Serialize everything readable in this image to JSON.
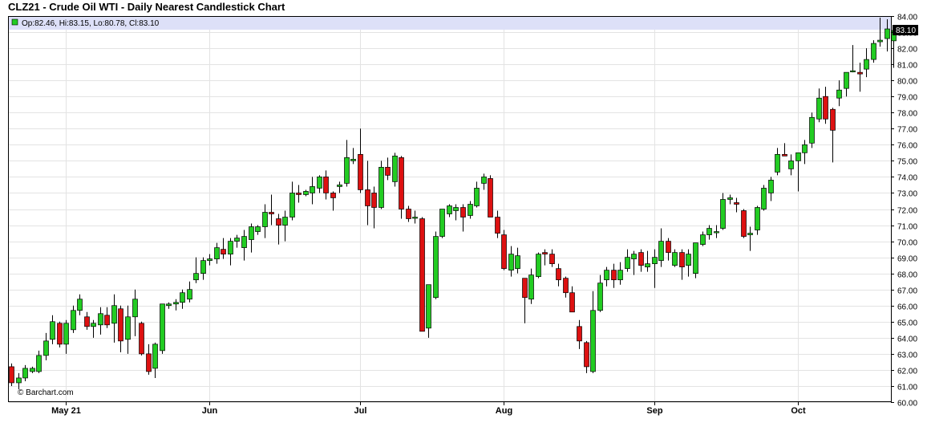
{
  "header": {
    "title": "CLZ21 - Crude Oil WTI - Daily Nearest Candlestick Chart"
  },
  "info_bar": {
    "ohlc_text": "Op:82.46, Hi:83.15, Lo:80.78, Cl:83.10",
    "last_price_label": "83.10"
  },
  "watermark": "© Barchart.com",
  "colors": {
    "up": "#22cc22",
    "down": "#dd1111",
    "grid": "#e3e3e3",
    "info_bar_bg": "#dde0f8",
    "info_swatch": "#22cc22"
  },
  "chart_data": {
    "type": "candlestick",
    "title": "CLZ21 - Crude Oil WTI - Daily Nearest Candlestick Chart",
    "ylim": [
      60,
      84
    ],
    "y_ticks": [
      "60.00",
      "61.00",
      "62.00",
      "63.00",
      "64.00",
      "65.00",
      "66.00",
      "67.00",
      "68.00",
      "69.00",
      "70.00",
      "71.00",
      "72.00",
      "73.00",
      "74.00",
      "75.00",
      "76.00",
      "77.00",
      "78.00",
      "79.00",
      "80.00",
      "81.00",
      "82.00",
      "83.00",
      "84.00"
    ],
    "x_month_labels": [
      {
        "label": "May 21",
        "index": 8
      },
      {
        "label": "Jun",
        "index": 29
      },
      {
        "label": "Jul",
        "index": 51
      },
      {
        "label": "Aug",
        "index": 72
      },
      {
        "label": "Sep",
        "index": 94
      },
      {
        "label": "Oct",
        "index": 115
      }
    ],
    "ohlc": [
      [
        62.2,
        62.4,
        61.0,
        61.2
      ],
      [
        61.2,
        61.8,
        60.8,
        61.5
      ],
      [
        61.5,
        62.3,
        61.3,
        62.1
      ],
      [
        61.9,
        62.2,
        61.8,
        62.1
      ],
      [
        61.9,
        63.2,
        61.8,
        62.9
      ],
      [
        62.9,
        64.3,
        62.6,
        63.8
      ],
      [
        63.9,
        65.4,
        63.6,
        65.0
      ],
      [
        64.9,
        65.0,
        63.4,
        63.6
      ],
      [
        63.6,
        65.1,
        63.0,
        64.9
      ],
      [
        64.5,
        66.0,
        64.3,
        65.7
      ],
      [
        65.7,
        66.7,
        65.4,
        66.4
      ],
      [
        65.3,
        65.6,
        64.5,
        64.7
      ],
      [
        64.7,
        65.1,
        64.0,
        64.9
      ],
      [
        64.8,
        65.9,
        64.2,
        65.5
      ],
      [
        65.4,
        65.9,
        64.6,
        64.8
      ],
      [
        64.9,
        66.7,
        63.7,
        66.0
      ],
      [
        65.8,
        66.0,
        63.1,
        63.8
      ],
      [
        63.9,
        66.0,
        63.0,
        65.3
      ],
      [
        65.3,
        67.0,
        64.1,
        66.4
      ],
      [
        64.9,
        65.0,
        62.9,
        63.0
      ],
      [
        63.0,
        63.6,
        61.7,
        61.9
      ],
      [
        62.1,
        63.7,
        61.5,
        63.6
      ],
      [
        63.2,
        66.0,
        63.0,
        66.1
      ],
      [
        66.0,
        66.2,
        65.8,
        66.1
      ],
      [
        66.1,
        66.4,
        65.7,
        66.2
      ],
      [
        66.2,
        67.0,
        65.8,
        66.8
      ],
      [
        66.4,
        67.5,
        66.2,
        67.0
      ],
      [
        67.6,
        69.0,
        67.4,
        68.0
      ],
      [
        68.0,
        69.0,
        67.6,
        68.8
      ],
      [
        68.8,
        69.2,
        68.5,
        68.9
      ],
      [
        68.9,
        69.9,
        68.6,
        69.6
      ],
      [
        69.5,
        70.2,
        68.9,
        69.2
      ],
      [
        69.2,
        70.2,
        68.5,
        70.0
      ],
      [
        70.0,
        70.4,
        69.6,
        70.2
      ],
      [
        69.6,
        70.7,
        68.8,
        70.3
      ],
      [
        70.1,
        71.1,
        69.3,
        70.9
      ],
      [
        70.6,
        71.0,
        70.4,
        70.9
      ],
      [
        70.9,
        72.3,
        70.2,
        71.8
      ],
      [
        71.8,
        72.9,
        71.0,
        71.7
      ],
      [
        71.4,
        71.7,
        69.8,
        71.0
      ],
      [
        71.0,
        71.9,
        70.0,
        71.5
      ],
      [
        71.5,
        73.7,
        71.3,
        73.0
      ],
      [
        73.0,
        73.5,
        72.4,
        72.9
      ],
      [
        72.9,
        73.2,
        72.8,
        73.1
      ],
      [
        73.0,
        74.0,
        72.3,
        73.4
      ],
      [
        73.3,
        74.1,
        73.0,
        74.0
      ],
      [
        74.0,
        74.4,
        72.6,
        73.0
      ],
      [
        73.0,
        73.1,
        71.9,
        72.7
      ],
      [
        73.4,
        73.7,
        73.0,
        73.5
      ],
      [
        73.6,
        76.3,
        73.4,
        75.2
      ],
      [
        75.0,
        75.8,
        74.8,
        75.1
      ],
      [
        75.4,
        77.0,
        73.0,
        73.2
      ],
      [
        73.2,
        75.0,
        71.0,
        72.2
      ],
      [
        73.0,
        73.4,
        70.8,
        72.1
      ],
      [
        72.1,
        75.0,
        72.0,
        74.6
      ],
      [
        74.6,
        75.2,
        73.8,
        74.1
      ],
      [
        73.7,
        75.5,
        73.4,
        75.3
      ],
      [
        75.2,
        75.3,
        71.4,
        72.0
      ],
      [
        72.0,
        72.2,
        71.2,
        71.4
      ],
      [
        71.5,
        71.9,
        71.1,
        71.5
      ],
      [
        71.4,
        71.5,
        64.6,
        64.4
      ],
      [
        64.6,
        67.1,
        64.0,
        67.3
      ],
      [
        66.5,
        70.6,
        66.4,
        70.3
      ],
      [
        70.3,
        72.0,
        70.2,
        72.0
      ],
      [
        71.7,
        72.3,
        71.5,
        72.2
      ],
      [
        71.9,
        72.3,
        71.3,
        72.1
      ],
      [
        72.1,
        72.3,
        70.6,
        71.5
      ],
      [
        71.6,
        72.5,
        71.4,
        72.3
      ],
      [
        72.2,
        73.7,
        72.1,
        73.3
      ],
      [
        73.6,
        74.2,
        73.2,
        74.0
      ],
      [
        73.9,
        74.1,
        71.5,
        71.5
      ],
      [
        71.5,
        71.9,
        70.2,
        70.5
      ],
      [
        70.4,
        70.7,
        68.2,
        68.3
      ],
      [
        68.2,
        69.7,
        67.8,
        69.2
      ],
      [
        68.3,
        69.6,
        68.0,
        69.1
      ],
      [
        67.7,
        67.7,
        64.9,
        66.5
      ],
      [
        66.4,
        68.3,
        66.1,
        67.9
      ],
      [
        67.8,
        69.3,
        67.7,
        69.2
      ],
      [
        69.3,
        69.5,
        68.5,
        69.2
      ],
      [
        69.2,
        69.5,
        68.4,
        68.6
      ],
      [
        68.3,
        68.6,
        67.2,
        67.6
      ],
      [
        67.7,
        67.8,
        66.5,
        66.8
      ],
      [
        66.8,
        67.2,
        65.6,
        65.6
      ],
      [
        64.7,
        65.1,
        63.3,
        63.8
      ],
      [
        63.7,
        63.8,
        61.8,
        62.2
      ],
      [
        61.9,
        66.9,
        61.8,
        65.7
      ],
      [
        65.7,
        67.9,
        65.6,
        67.4
      ],
      [
        67.6,
        68.4,
        67.2,
        68.2
      ],
      [
        68.2,
        68.6,
        67.1,
        67.6
      ],
      [
        67.6,
        68.7,
        67.3,
        68.2
      ],
      [
        68.3,
        69.5,
        68.1,
        69.0
      ],
      [
        68.9,
        69.4,
        67.9,
        69.2
      ],
      [
        69.3,
        69.5,
        68.1,
        68.5
      ],
      [
        68.4,
        69.4,
        68.1,
        68.6
      ],
      [
        68.6,
        69.5,
        67.1,
        69.0
      ],
      [
        68.8,
        70.8,
        68.4,
        70.0
      ],
      [
        70.0,
        70.2,
        68.8,
        69.3
      ],
      [
        68.5,
        69.5,
        68.4,
        69.3
      ],
      [
        69.3,
        69.5,
        67.6,
        68.4
      ],
      [
        68.5,
        69.5,
        67.8,
        69.2
      ],
      [
        68.0,
        69.8,
        67.7,
        69.9
      ],
      [
        69.8,
        70.6,
        69.7,
        70.4
      ],
      [
        70.4,
        71.0,
        70.1,
        70.8
      ],
      [
        70.6,
        71.0,
        70.2,
        70.6
      ],
      [
        70.8,
        73.0,
        70.7,
        72.6
      ],
      [
        72.6,
        72.9,
        72.3,
        72.7
      ],
      [
        72.4,
        72.7,
        71.8,
        72.3
      ],
      [
        71.9,
        72.0,
        70.2,
        70.3
      ],
      [
        70.4,
        70.9,
        69.4,
        70.5
      ],
      [
        70.7,
        72.2,
        70.4,
        72.1
      ],
      [
        72.0,
        73.5,
        71.9,
        73.3
      ],
      [
        73.0,
        74.0,
        72.5,
        73.8
      ],
      [
        74.3,
        75.8,
        74.1,
        75.4
      ],
      [
        75.4,
        76.1,
        75.3,
        75.3
      ],
      [
        74.5,
        75.4,
        74.1,
        75.0
      ],
      [
        75.0,
        75.2,
        73.1,
        75.5
      ],
      [
        75.5,
        76.3,
        74.8,
        76.0
      ],
      [
        76.1,
        78.0,
        75.8,
        77.7
      ],
      [
        77.6,
        79.5,
        77.4,
        78.9
      ],
      [
        79.0,
        79.6,
        77.3,
        77.6
      ],
      [
        78.2,
        78.3,
        74.9,
        76.9
      ],
      [
        78.9,
        80.0,
        78.4,
        79.4
      ],
      [
        79.5,
        80.5,
        79.0,
        80.5
      ],
      [
        80.6,
        82.2,
        80.5,
        80.6
      ],
      [
        80.5,
        81.1,
        79.3,
        80.4
      ],
      [
        80.7,
        82.0,
        80.2,
        81.3
      ],
      [
        81.3,
        82.5,
        81.1,
        82.3
      ],
      [
        82.4,
        83.9,
        82.1,
        82.5
      ],
      [
        82.6,
        83.8,
        81.8,
        83.2
      ],
      [
        82.46,
        83.15,
        80.78,
        83.1
      ]
    ]
  }
}
